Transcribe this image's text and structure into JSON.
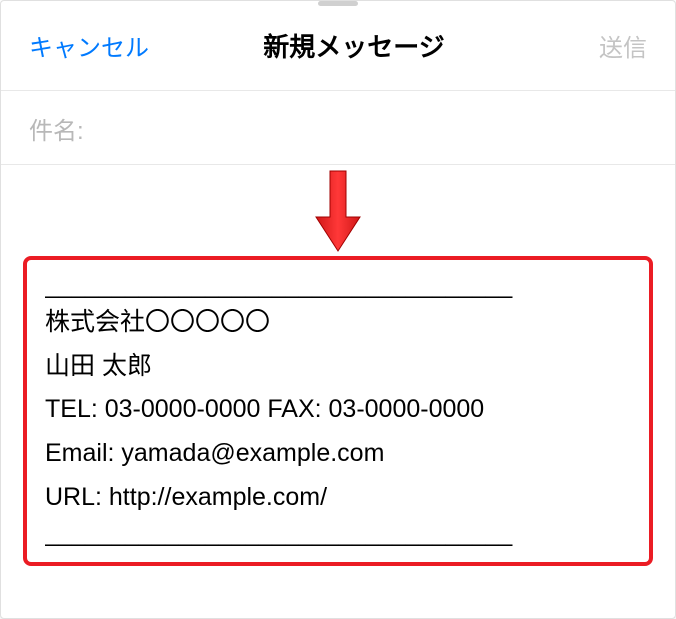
{
  "header": {
    "cancel_label": "キャンセル",
    "title": "新規メッセージ",
    "send_label": "送信"
  },
  "subject": {
    "label": "件名:"
  },
  "signature": {
    "divider": "___________________________________",
    "company": "株式会社〇〇〇〇〇",
    "name": "山田 太郎",
    "tel_fax": "TEL: 03-0000-0000 FAX: 03-0000-0000",
    "email": "Email: yamada@example.com",
    "url": "URL: http://example.com/",
    "divider2": "___________________________________"
  }
}
